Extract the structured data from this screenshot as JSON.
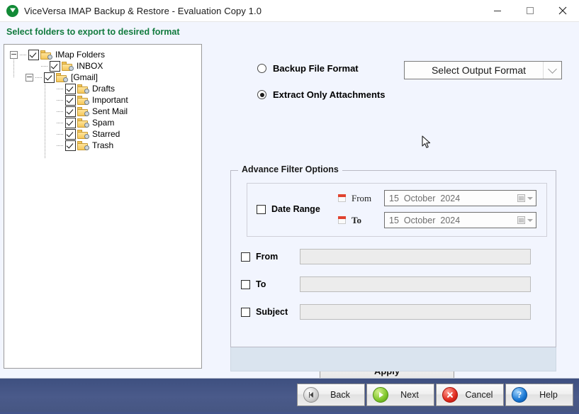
{
  "window": {
    "title": "ViceVersa IMAP Backup & Restore - Evaluation Copy 1.0",
    "app_icon": "green-down-triangle-icon",
    "minimize_label": "Minimize",
    "maximize_label": "Maximize",
    "close_label": "Close"
  },
  "header": {
    "instruction": "Select folders to export to desired format",
    "instruction_color": "#117a3d"
  },
  "tree": {
    "nodes": [
      {
        "label": "IMap Folders",
        "level": 0,
        "checked": true,
        "expander": "collapse",
        "icon": "folder-search-icon"
      },
      {
        "label": "INBOX",
        "level": 1,
        "checked": true,
        "expander": "none",
        "icon": "folder-search-icon"
      },
      {
        "label": "[Gmail]",
        "level": 1,
        "checked": true,
        "expander": "collapse",
        "icon": "folder-search-icon"
      },
      {
        "label": "Drafts",
        "level": 2,
        "checked": true,
        "expander": "none",
        "icon": "folder-search-icon"
      },
      {
        "label": "Important",
        "level": 2,
        "checked": true,
        "expander": "none",
        "icon": "folder-search-icon"
      },
      {
        "label": "Sent Mail",
        "level": 2,
        "checked": true,
        "expander": "none",
        "icon": "folder-search-icon"
      },
      {
        "label": "Spam",
        "level": 2,
        "checked": true,
        "expander": "none",
        "icon": "folder-search-icon"
      },
      {
        "label": "Starred",
        "level": 2,
        "checked": true,
        "expander": "none",
        "icon": "folder-search-icon"
      },
      {
        "label": "Trash",
        "level": 2,
        "checked": true,
        "expander": "none",
        "icon": "folder-search-icon"
      }
    ]
  },
  "options": {
    "backup_format_label": "Backup File Format",
    "backup_format_selected": false,
    "extract_attachments_label": "Extract Only Attachments",
    "extract_attachments_selected": true,
    "output_format_value": "Select Output Format"
  },
  "filters": {
    "group_title": "Advance Filter Options",
    "date_range_label": "Date Range",
    "date_range_checked": false,
    "from_date_label": "From",
    "to_date_label": "To",
    "from_date": {
      "day": "15",
      "month": "October",
      "year": "2024"
    },
    "to_date": {
      "day": "15",
      "month": "October",
      "year": "2024"
    },
    "from_label": "From",
    "from_checked": false,
    "from_value": "",
    "to_label": "To",
    "to_checked": false,
    "to_value": "",
    "subject_label": "Subject",
    "subject_checked": false,
    "subject_value": "",
    "apply_label": "Apply"
  },
  "footer": {
    "buttons": [
      {
        "label": "Back",
        "icon": "rewind-icon"
      },
      {
        "label": "Next",
        "icon": "play-icon"
      },
      {
        "label": "Cancel",
        "icon": "cancel-x-icon"
      },
      {
        "label": "Help",
        "icon": "question-mark-icon"
      }
    ]
  }
}
